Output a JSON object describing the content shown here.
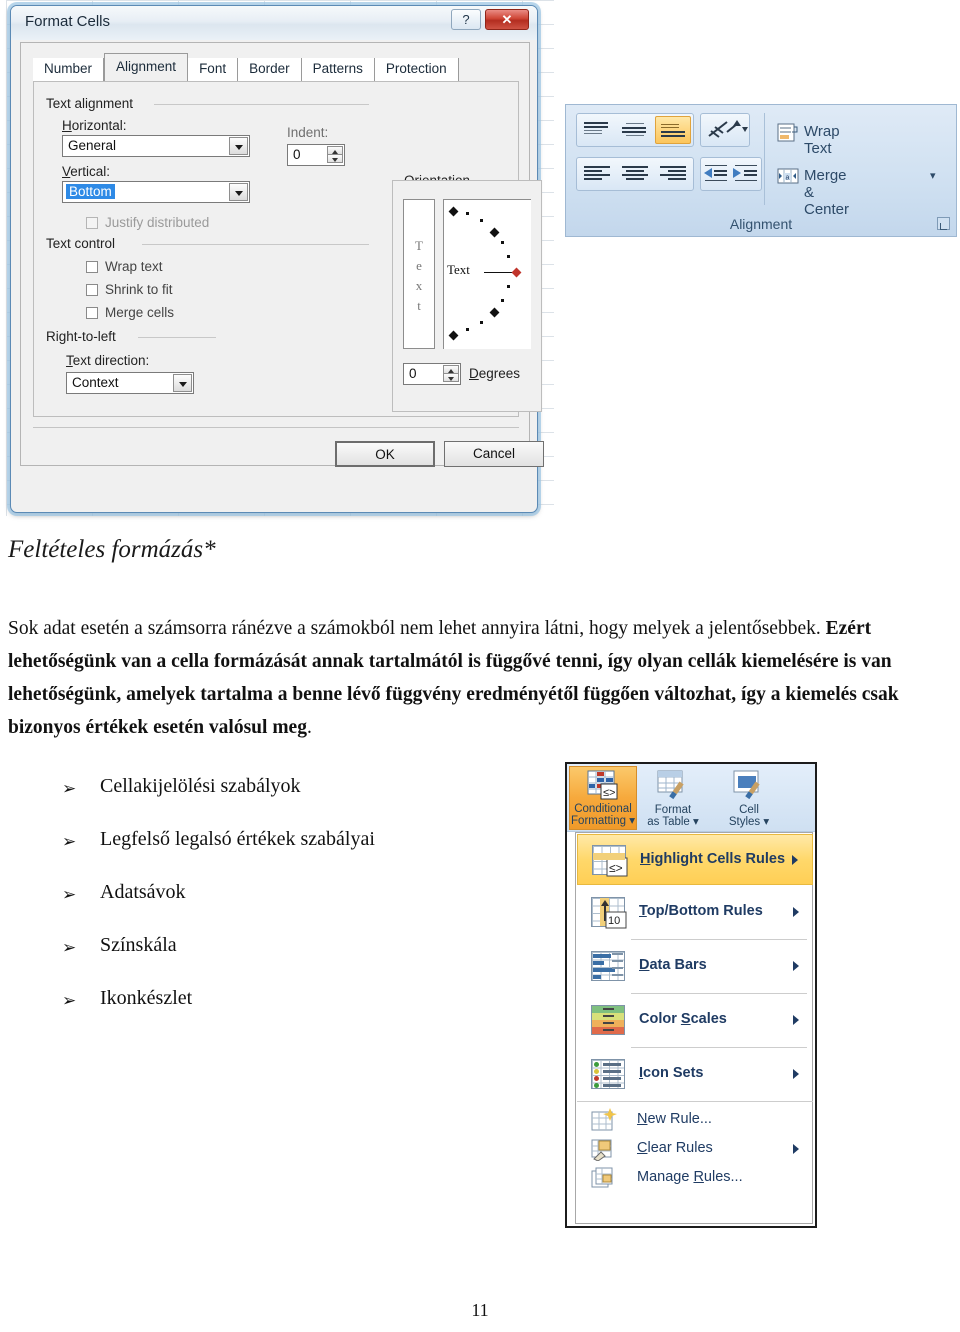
{
  "dialog": {
    "title": "Format Cells",
    "help_button": "?",
    "close_button": "✕",
    "tabs": [
      {
        "label": "Number",
        "active": false
      },
      {
        "label": "Alignment",
        "active": true
      },
      {
        "label": "Font",
        "active": false
      },
      {
        "label": "Border",
        "active": false
      },
      {
        "label": "Patterns",
        "active": false
      },
      {
        "label": "Protection",
        "active": false
      }
    ],
    "text_alignment": {
      "group_label": "Text alignment",
      "horizontal_label": "Horizontal:",
      "horizontal_value": "General",
      "vertical_label": "Vertical:",
      "vertical_value": "Bottom",
      "indent_label": "Indent:",
      "indent_value": "0",
      "justify_distributed_label": "Justify distributed"
    },
    "text_control": {
      "group_label": "Text control",
      "wrap_text_label": "Wrap text",
      "shrink_to_fit_label": "Shrink to fit",
      "merge_cells_label": "Merge cells"
    },
    "right_to_left": {
      "group_label": "Right-to-left",
      "text_direction_label": "Text direction:",
      "text_direction_value": "Context"
    },
    "orientation": {
      "group_label": "Orientation",
      "vertical_text_chars": [
        "T",
        "e",
        "x",
        "t"
      ],
      "dial_text": "Text",
      "degrees_value": "0",
      "degrees_label": "Degrees"
    },
    "buttons": {
      "ok": "OK",
      "cancel": "Cancel"
    }
  },
  "ribbon_alignment": {
    "group_label": "Alignment",
    "align_top": "align-top",
    "align_middle": "align-middle",
    "align_bottom": "align-bottom",
    "orientation": "text-orientation",
    "align_left": "align-left",
    "align_center": "align-center",
    "align_right": "align-right",
    "decrease_indent": "decrease-indent",
    "increase_indent": "increase-indent",
    "wrap_text_label": "Wrap Text",
    "merge_center_label": "Merge & Center",
    "dialog_launcher": "dialog-launcher"
  },
  "document": {
    "heading": "Feltételes formázás*",
    "paragraph_part1": "Sok adat esetén a számsorra ránézve a számokból nem lehet annyira látni, hogy melyek a jelentősebbek. ",
    "paragraph_bold": "Ezért lehetőségünk van a cella formázását annak tartalmától is függővé tenni, így olyan cellák kiemelésére is van lehetőségünk, amelyek tartalma a benne lévő függvény eredményétől függően változhat, így a kiemelés csak bizonyos értékek esetén valósul meg",
    "paragraph_end": ".",
    "bullet_marker": "➢",
    "bullets": [
      "Cellakijelölési szabályok",
      "Legfelső legalsó értékek szabályai",
      "Adatsávok",
      "Színskála",
      "Ikonkészlet"
    ],
    "page_number": "11"
  },
  "cf_screenshot": {
    "tiles": [
      {
        "line1": "Conditional",
        "line2": "Formatting ▾",
        "active": true
      },
      {
        "line1": "Format",
        "line2": "as Table ▾",
        "active": false
      },
      {
        "line1": "Cell",
        "line2": "Styles ▾",
        "active": false
      }
    ],
    "menu": [
      {
        "label": "Highlight Cells Rules",
        "submenu": true,
        "highlighted": true,
        "icon": "highlight-cells-icon"
      },
      {
        "label": "Top/Bottom Rules",
        "submenu": true,
        "highlighted": false,
        "icon": "top-bottom-icon"
      },
      {
        "label": "Data Bars",
        "submenu": true,
        "highlighted": false,
        "icon": "data-bars-icon"
      },
      {
        "label": "Color Scales",
        "submenu": true,
        "highlighted": false,
        "icon": "color-scales-icon"
      },
      {
        "label": "Icon Sets",
        "submenu": true,
        "highlighted": false,
        "icon": "icon-sets-icon"
      },
      {
        "label": "New Rule...",
        "submenu": false,
        "highlighted": false,
        "icon": "new-rule-icon"
      },
      {
        "label": "Clear Rules",
        "submenu": true,
        "highlighted": false,
        "icon": "clear-rules-icon"
      },
      {
        "label": "Manage Rules...",
        "submenu": false,
        "highlighted": false,
        "icon": "manage-rules-icon"
      }
    ]
  },
  "colors": {
    "accent_orange": "#f6a93c",
    "selection_blue": "#2e8ae6",
    "ribbon_blue": "#cfe0f1",
    "menu_text": "#1f3b63",
    "close_red": "#cf4535"
  }
}
